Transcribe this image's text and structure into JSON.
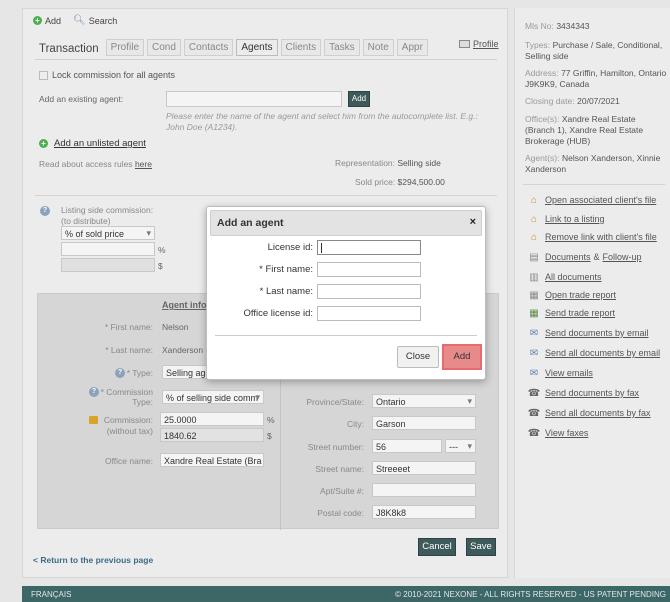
{
  "toolbar": {
    "add_label": "Add",
    "search_label": "Search"
  },
  "tabs": {
    "title": "Transaction",
    "items": [
      "Profile",
      "Cond",
      "Contacts",
      "Agents",
      "Clients",
      "Tasks",
      "Note",
      "Appr"
    ],
    "active": "Agents",
    "profile_link": "Profile"
  },
  "agents": {
    "lock_commission_label": "Lock commission for all agents",
    "existing_agent_label": "Add an existing agent:",
    "existing_agent_value": "",
    "add_button": "Add",
    "hint": "Please enter the name of the agent and select him from the autocomplete list. E.g.: John Doe (A1234).",
    "add_unlisted_label": "Add an unlisted agent",
    "access_rules_prefix": "Read about access rules",
    "access_rules_link": "here",
    "representation_label": "Representation:",
    "representation_value": "Selling side",
    "sold_price_label": "Sold price:",
    "sold_price_value": "$294,500.00",
    "listing_commission_label": "Listing side commission:",
    "listing_commission_sub": "(to distribute)",
    "listing_commission_type": "% of sold price",
    "percent_sign": "%",
    "dollar_sign": "$"
  },
  "agent_form": {
    "header": "Agent infor",
    "first_name_label": "* First name:",
    "first_name_value": "Nelson",
    "last_name_label": "* Last name:",
    "last_name_value": "Xanderson",
    "type_label": "* Type:",
    "type_value": "Selling agent",
    "commission_type_label": "* Commission Type:",
    "commission_type_value": "% of selling side comm",
    "commission_label": "Commission:",
    "commission_sub": "(without tax)",
    "commission_percent": "25.0000",
    "commission_amount": "1840.62",
    "office_name_label": "Office name:",
    "office_name_value": "Xandre Real Estate (Bra",
    "province_label": "Province/State:",
    "province_value": "Ontario",
    "city_label": "City:",
    "city_value": "Garson",
    "street_number_label": "Street number:",
    "street_number_value": "56",
    "street_suffix_value": "---",
    "street_name_label": "Street name:",
    "street_name_value": "Streeeet",
    "apt_label": "Apt/Suite #:",
    "apt_value": "",
    "postal_code_label": "Postal code:",
    "postal_code_value": "J8K8k8"
  },
  "nav": {
    "back_link": "< Return to the previous page",
    "cancel_button": "Cancel",
    "save_button": "Save"
  },
  "dialog": {
    "title": "Add an agent",
    "close_glyph": "×",
    "license_label": "License id:",
    "first_name_label": "* First name:",
    "last_name_label": "* Last name:",
    "office_license_label": "Office license id:",
    "close_button": "Close",
    "add_button": "Add"
  },
  "sidebar": {
    "mls_label": "Mls No:",
    "mls_value": "3434343",
    "types_label": "Types:",
    "types_value": "Purchase / Sale, Conditional, Selling side",
    "address_label": "Address:",
    "address_value": "77 Griffin, Hamilton, Ontario J9K9K9, Canada",
    "closing_label": "Closing date:",
    "closing_value": "20/07/2021",
    "offices_label": "Office(s):",
    "offices_value": "Xandre Real Estate (Branch 1), Xandre Real Estate Brokerage (HUB)",
    "agents_label": "Agent(s):",
    "agents_value": "Nelson Xanderson, Xinnie Xanderson",
    "actions": [
      {
        "label": "Open associated client's file",
        "icon": "house-icon"
      },
      {
        "label": "Link to a listing",
        "icon": "home-link-icon"
      },
      {
        "label": "Remove link with client's file",
        "icon": "house-remove-icon"
      },
      {
        "label": "Documents",
        "label2": "Follow-up",
        "amp": "&",
        "icon": "document-icon"
      },
      {
        "label": "All documents",
        "icon": "all-documents-icon"
      },
      {
        "label": "Open trade report",
        "icon": "report-icon"
      },
      {
        "label": "Send trade report",
        "icon": "send-report-icon"
      },
      {
        "label": "Send documents by email",
        "icon": "email-icon"
      },
      {
        "label": "Send all documents by email",
        "icon": "email-all-icon"
      },
      {
        "label": "View emails",
        "icon": "view-email-icon"
      },
      {
        "label": "Send documents by fax",
        "icon": "fax-icon"
      },
      {
        "label": "Send all documents by fax",
        "icon": "fax-all-icon"
      },
      {
        "label": "View faxes",
        "icon": "view-fax-icon"
      }
    ]
  },
  "footer": {
    "language": "FRANÇAIS",
    "copyright": "© 2010-2021 NEXONE - ALL RIGHTS RESERVED - US PATENT PENDING"
  }
}
